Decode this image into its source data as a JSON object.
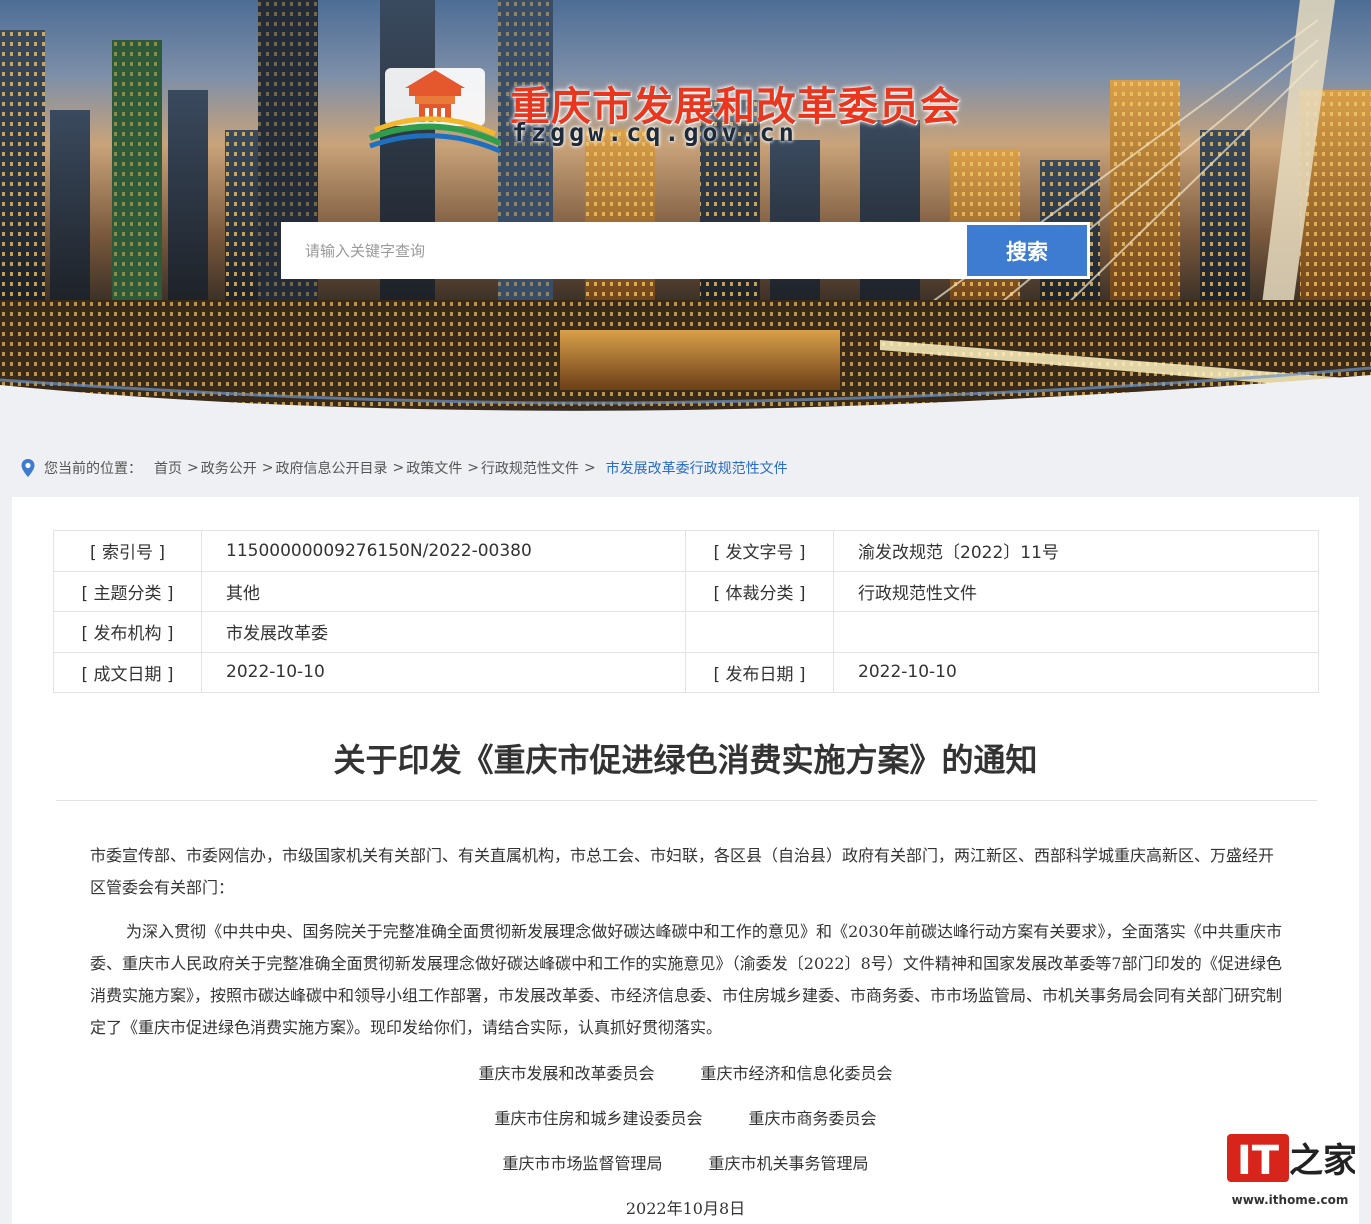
{
  "header": {
    "site_title": "重庆市发展和改革委员会",
    "site_domain": "fzggw.cq.gov.cn",
    "search_placeholder": "请输入关键字查询",
    "search_button": "搜索"
  },
  "breadcrumb": {
    "lead": "您当前的位置：",
    "items": [
      "首页",
      "政务公开",
      "政府信息公开目录",
      "政策文件",
      "行政规范性文件"
    ],
    "current": "市发展改革委行政规范性文件"
  },
  "meta": {
    "rows": [
      {
        "k1": "[ 索引号 ]",
        "v1": "11500000009276150N/2022-00380",
        "k2": "[ 发文字号 ]",
        "v2": "渝发改规范〔2022〕11号"
      },
      {
        "k1": "[ 主题分类 ]",
        "v1": "其他",
        "k2": "[ 体裁分类 ]",
        "v2": "行政规范性文件"
      },
      {
        "k1": "[ 发布机构 ]",
        "v1": "市发展改革委",
        "k2": "",
        "v2": ""
      },
      {
        "k1": "[ 成文日期 ]",
        "v1": "2022-10-10",
        "k2": "[ 发布日期 ]",
        "v2": "2022-10-10"
      }
    ]
  },
  "document": {
    "title": "关于印发《重庆市促进绿色消费实施方案》的通知",
    "addressee": "市委宣传部、市委网信办，市级国家机关有关部门、有关直属机构，市总工会、市妇联，各区县（自治县）政府有关部门，两江新区、西部科学城重庆高新区、万盛经开区管委会有关部门：",
    "body": "为深入贯彻《中共中央、国务院关于完整准确全面贯彻新发展理念做好碳达峰碳中和工作的意见》和《2030年前碳达峰行动方案有关要求》，全面落实《中共重庆市委、重庆市人民政府关于完整准确全面贯彻新发展理念做好碳达峰碳中和工作的实施意见》（渝委发〔2022〕8号）文件精神和国家发展改革委等7部门印发的《促进绿色消费实施方案》，按照市碳达峰碳中和领导小组工作部署，市发展改革委、市经济信息委、市住房城乡建委、市商务委、市市场监管局、市机关事务局会同有关部门研究制定了《重庆市促进绿色消费实施方案》。现印发给你们，请结合实际，认真抓好贯彻落实。",
    "signatories": [
      [
        "重庆市发展和改革委员会",
        "重庆市经济和信息化委员会"
      ],
      [
        "重庆市住房和城乡建设委员会",
        "重庆市商务委员会"
      ],
      [
        "重庆市市场监督管理局",
        "重庆市机关事务管理局"
      ]
    ],
    "date": "2022年10月8日"
  },
  "watermark": {
    "brand": "IT之家",
    "url": "www.ithome.com"
  },
  "colors": {
    "accent_blue": "#3d7cd1",
    "title_red": "#e8361f",
    "breadcrumb_current": "#2b6cc4"
  }
}
